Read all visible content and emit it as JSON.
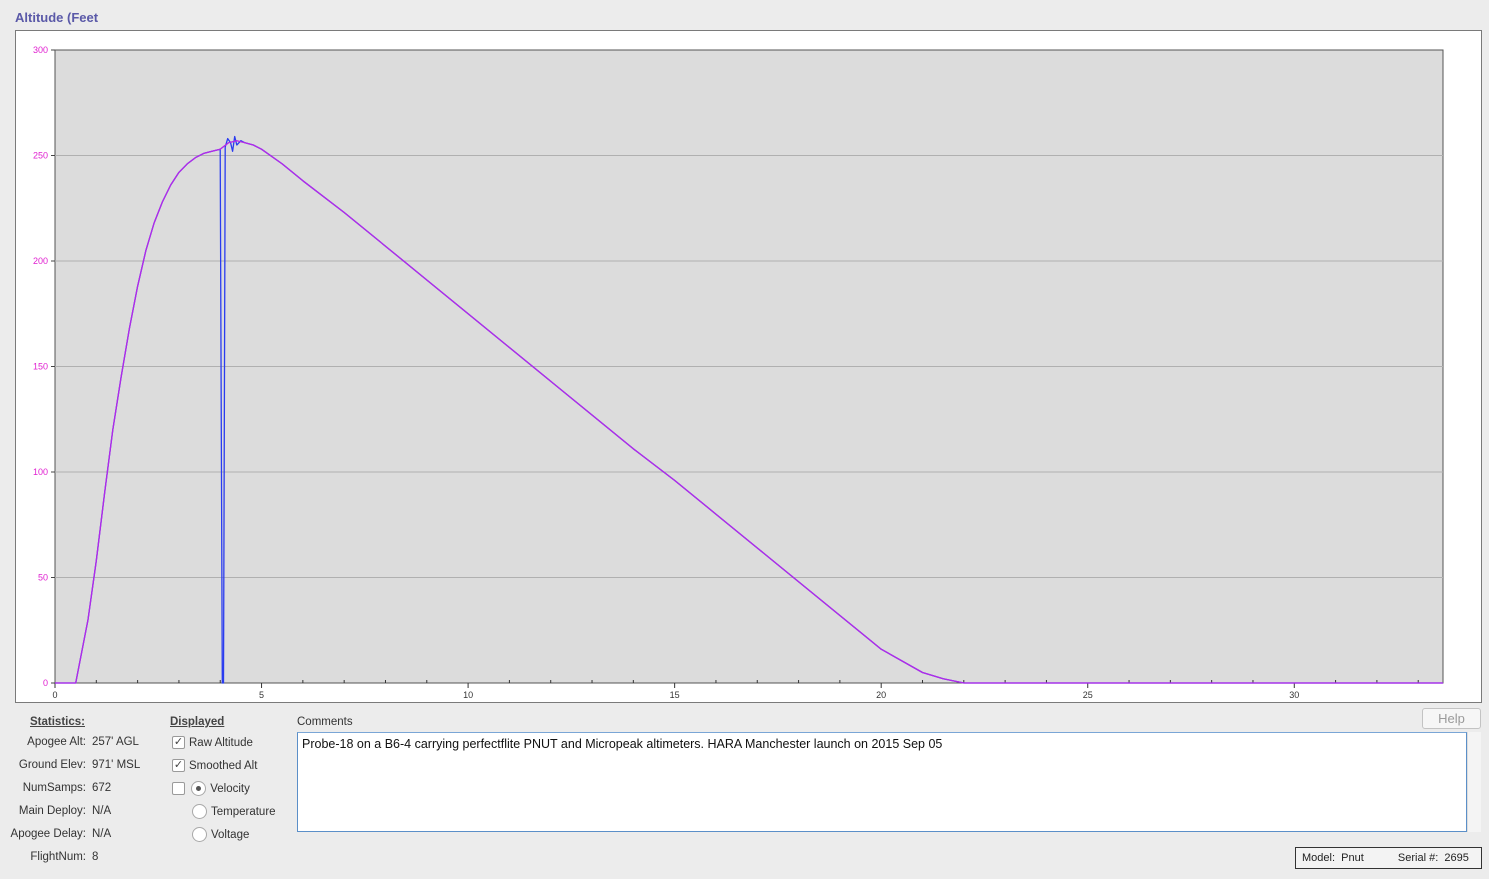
{
  "chart": {
    "title": "Altitude (Feet"
  },
  "chart_data": {
    "type": "line",
    "title": "Altitude (Feet",
    "xlabel": "",
    "ylabel": "",
    "xlim": [
      0,
      33.6
    ],
    "ylim": [
      0,
      300
    ],
    "x_ticks": [
      "0",
      "5",
      "10",
      "15",
      "20",
      "25",
      "30"
    ],
    "y_ticks": [
      "0",
      "50",
      "100",
      "150",
      "200",
      "250",
      "300"
    ],
    "grid": "horizontal",
    "colors": {
      "raw": "#2a3cf0",
      "smoothed": "#b429e8",
      "plot_bg": "#dcdcdc",
      "ytick_text": "#e020d0",
      "xtick_text": "#333333",
      "grid": "#b0b0b0"
    },
    "series": [
      {
        "name": "Raw Altitude",
        "x": [
          0,
          0.5,
          0.8,
          1.0,
          1.2,
          1.4,
          1.6,
          1.8,
          2.0,
          2.2,
          2.4,
          2.6,
          2.8,
          3.0,
          3.2,
          3.4,
          3.6,
          3.8,
          4.0,
          4.05,
          4.08,
          4.12,
          4.18,
          4.25,
          4.3,
          4.35,
          4.4,
          4.5,
          4.6,
          4.8,
          5.0,
          5.5,
          6.0,
          7.0,
          8.0,
          9.0,
          10.0,
          11.0,
          12.0,
          13.0,
          14.0,
          15.0,
          16.0,
          17.0,
          18.0,
          19.0,
          20.0,
          21.0,
          21.5,
          22.0,
          25,
          30,
          33.6
        ],
        "y": [
          0,
          0,
          30,
          58,
          90,
          120,
          145,
          168,
          188,
          205,
          218,
          228,
          236,
          242,
          246,
          249,
          251,
          252,
          253,
          0,
          0,
          254,
          258,
          256,
          252,
          259,
          255,
          257,
          256,
          255,
          253,
          246,
          238,
          223,
          207,
          191,
          175,
          159,
          143,
          127,
          111,
          96,
          80,
          64,
          48,
          32,
          16,
          5,
          2,
          0,
          0,
          0,
          0
        ]
      },
      {
        "name": "Smoothed Alt",
        "x": [
          0,
          0.5,
          0.8,
          1.0,
          1.2,
          1.4,
          1.6,
          1.8,
          2.0,
          2.2,
          2.4,
          2.6,
          2.8,
          3.0,
          3.2,
          3.4,
          3.6,
          3.8,
          4.0,
          4.2,
          4.4,
          4.6,
          4.8,
          5.0,
          5.5,
          6.0,
          7.0,
          8.0,
          9.0,
          10.0,
          11.0,
          12.0,
          13.0,
          14.0,
          15.0,
          16.0,
          17.0,
          18.0,
          19.0,
          20.0,
          21.0,
          21.5,
          22.0,
          25,
          30,
          33.6
        ],
        "y": [
          0,
          0,
          30,
          58,
          90,
          120,
          145,
          168,
          188,
          205,
          218,
          228,
          236,
          242,
          246,
          249,
          251,
          252,
          253,
          256,
          257,
          256,
          255,
          253,
          246,
          238,
          223,
          207,
          191,
          175,
          159,
          143,
          127,
          111,
          96,
          80,
          64,
          48,
          32,
          16,
          5,
          2,
          0,
          0,
          0,
          0
        ]
      }
    ]
  },
  "statistics": {
    "header": "Statistics:",
    "rows": [
      {
        "label": "Apogee Alt:",
        "value": "257' AGL"
      },
      {
        "label": "Ground Elev:",
        "value": "971' MSL"
      },
      {
        "label": "NumSamps:",
        "value": "672"
      },
      {
        "label": "Main Deploy:",
        "value": "N/A"
      },
      {
        "label": "Apogee Delay:",
        "value": "N/A"
      },
      {
        "label": "FlightNum:",
        "value": "8"
      }
    ]
  },
  "displayed": {
    "header": "Displayed",
    "raw_altitude": {
      "label": "Raw Altitude",
      "checked": true
    },
    "smoothed_alt": {
      "label": "Smoothed Alt",
      "checked": true
    },
    "third_series": {
      "checked": false
    },
    "options": [
      {
        "label": "Velocity",
        "selected": true
      },
      {
        "label": "Temperature",
        "selected": false
      },
      {
        "label": "Voltage",
        "selected": false
      }
    ]
  },
  "comments": {
    "label": "Comments",
    "text": "Probe-18 on a B6-4 carrying perfectflite PNUT and Micropeak altimeters. HARA Manchester launch on 2015 Sep 05"
  },
  "help_button": {
    "label": "Help"
  },
  "device": {
    "model_label": "Model:",
    "model_value": "Pnut",
    "serial_label": "Serial #:",
    "serial_value": "2695"
  }
}
